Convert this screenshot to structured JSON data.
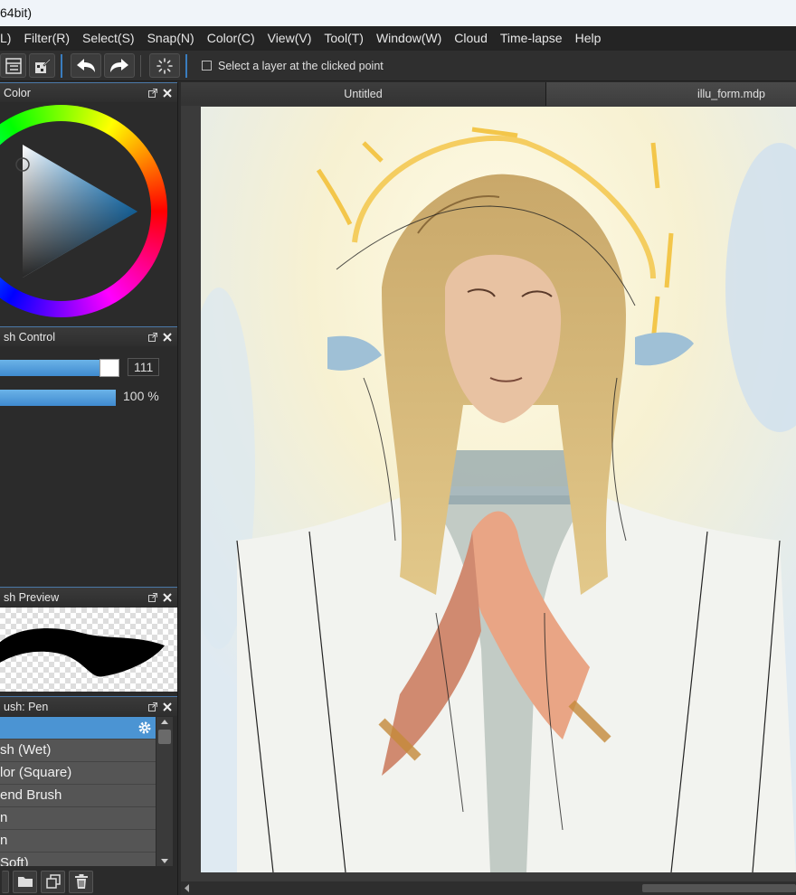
{
  "window": {
    "title": "64bit)"
  },
  "menu": [
    "L)",
    "Filter(R)",
    "Select(S)",
    "Snap(N)",
    "Color(C)",
    "View(V)",
    "Tool(T)",
    "Window(W)",
    "Cloud",
    "Time-lapse",
    "Help"
  ],
  "toolbar": {
    "checkbox_label": "Select a layer at the clicked point",
    "checkbox_checked": false
  },
  "panels": {
    "color": {
      "title": "Color",
      "hue_color": "#1ea0ff"
    },
    "brush_control": {
      "title": "sh Control",
      "size_value": "111",
      "opacity_value": "100 %",
      "opacity_level": 1.0
    },
    "brush_preview": {
      "title": "sh Preview"
    },
    "brush_list": {
      "title": "ush: Pen",
      "items": [
        "",
        "sh (Wet)",
        "lor (Square)",
        "end Brush",
        "n",
        "n",
        "Soft)"
      ]
    }
  },
  "tabs": [
    {
      "label": "Untitled",
      "active": false
    },
    {
      "label": "illu_form.mdp",
      "active": true
    }
  ],
  "icons": {
    "toolbar": [
      "layer-settings-icon",
      "layer-edit-icon",
      "undo-icon",
      "redo-icon",
      "deselect-icon"
    ],
    "left_bottom": [
      "new-layer-icon",
      "folder-icon",
      "duplicate-icon",
      "delete-icon"
    ]
  }
}
